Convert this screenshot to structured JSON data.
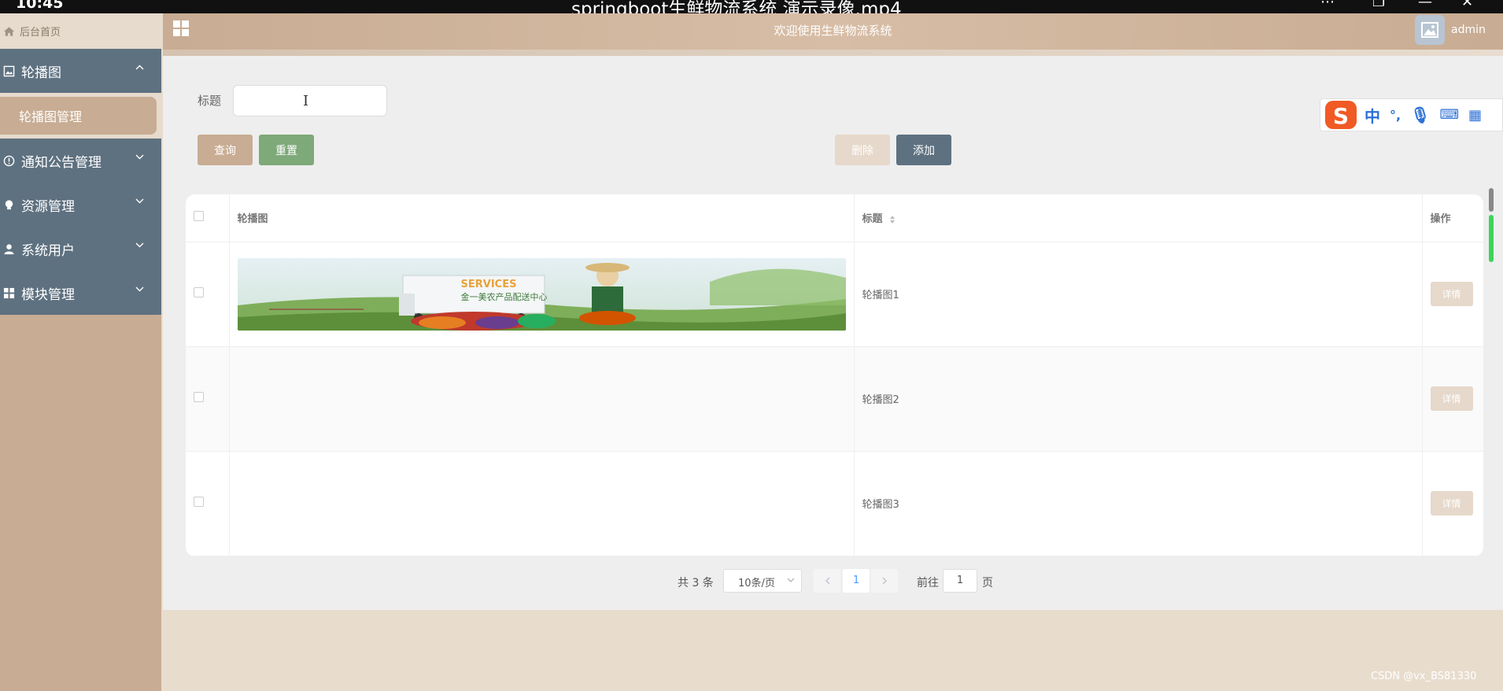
{
  "overlay": {
    "time": "10:45",
    "video_title": "springboot生鲜物流系统 演示录像.mp4",
    "watermark": "CSDN @vx_BS81330"
  },
  "sidebar": {
    "home_label": "后台首页",
    "menu": [
      {
        "label": "轮播图",
        "expanded": true,
        "icon": "image-icon"
      },
      {
        "label": "通知公告管理",
        "expanded": false,
        "icon": "info-icon"
      },
      {
        "label": "资源管理",
        "expanded": false,
        "icon": "bulb-icon"
      },
      {
        "label": "系统用户",
        "expanded": false,
        "icon": "user-icon"
      },
      {
        "label": "模块管理",
        "expanded": false,
        "icon": "grid-icon"
      }
    ],
    "submenu_active": "轮播图管理"
  },
  "header": {
    "title": "欢迎使用生鲜物流系统",
    "username": "admin"
  },
  "filter": {
    "label": "标题",
    "value": ""
  },
  "toolbar": {
    "query": "查询",
    "reset": "重置",
    "delete": "删除",
    "add": "添加"
  },
  "table": {
    "columns": [
      "轮播图",
      "标题",
      "操作"
    ],
    "rows": [
      {
        "title": "轮播图1",
        "action": "详情",
        "banner_text": "SERVICES",
        "banner_sub": "金一美农产品配送中心"
      },
      {
        "title": "轮播图2",
        "action": "详情"
      },
      {
        "title": "轮播图3",
        "action": "详情"
      }
    ]
  },
  "pagination": {
    "total": "共 3 条",
    "page_size": "10条/页",
    "current_page": "1",
    "goto_label": "前往",
    "goto_value": "1",
    "page_suffix": "页"
  },
  "ime": {
    "mode": "中",
    "punct": "°,"
  },
  "colors": {
    "accent": "#c8ac93",
    "sidebar_menu": "#5e7180",
    "reset": "#7ea979"
  }
}
